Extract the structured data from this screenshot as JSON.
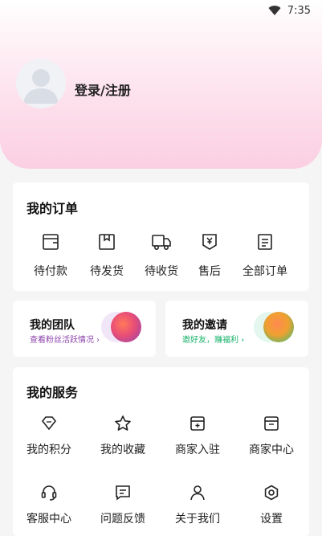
{
  "status_bar": {
    "time": "7:35",
    "wifi_icon": "wifi-icon"
  },
  "header": {
    "avatar_icon": "avatar-placeholder-icon",
    "login_label": "登录/注册"
  },
  "orders": {
    "title": "我的订单",
    "items": [
      {
        "label": "待付款",
        "icon": "wallet-icon"
      },
      {
        "label": "待发货",
        "icon": "package-icon"
      },
      {
        "label": "待收货",
        "icon": "truck-icon"
      },
      {
        "label": "售后",
        "icon": "after-sale-icon"
      },
      {
        "label": "全部订单",
        "icon": "order-list-icon"
      }
    ]
  },
  "promos": {
    "team": {
      "title": "我的团队",
      "subtitle": "查看粉丝活跃情况 ›",
      "subtitle_color": "#8e44ad"
    },
    "invite": {
      "title": "我的邀请",
      "subtitle": "邀好友，赚福利 ›",
      "subtitle_color": "#19b36b"
    }
  },
  "services": {
    "title": "我的服务",
    "items": [
      {
        "label": "我的积分",
        "icon": "diamond-icon"
      },
      {
        "label": "我的收藏",
        "icon": "star-icon"
      },
      {
        "label": "商家入驻",
        "icon": "store-add-icon"
      },
      {
        "label": "商家中心",
        "icon": "store-icon"
      },
      {
        "label": "客服中心",
        "icon": "headset-icon"
      },
      {
        "label": "问题反馈",
        "icon": "feedback-icon"
      },
      {
        "label": "关于我们",
        "icon": "user-icon"
      },
      {
        "label": "设置",
        "icon": "settings-icon"
      }
    ]
  },
  "colors": {
    "header_pink": "#fbcfe2",
    "card_bg": "#ffffff",
    "page_bg": "#f5f5f5"
  }
}
